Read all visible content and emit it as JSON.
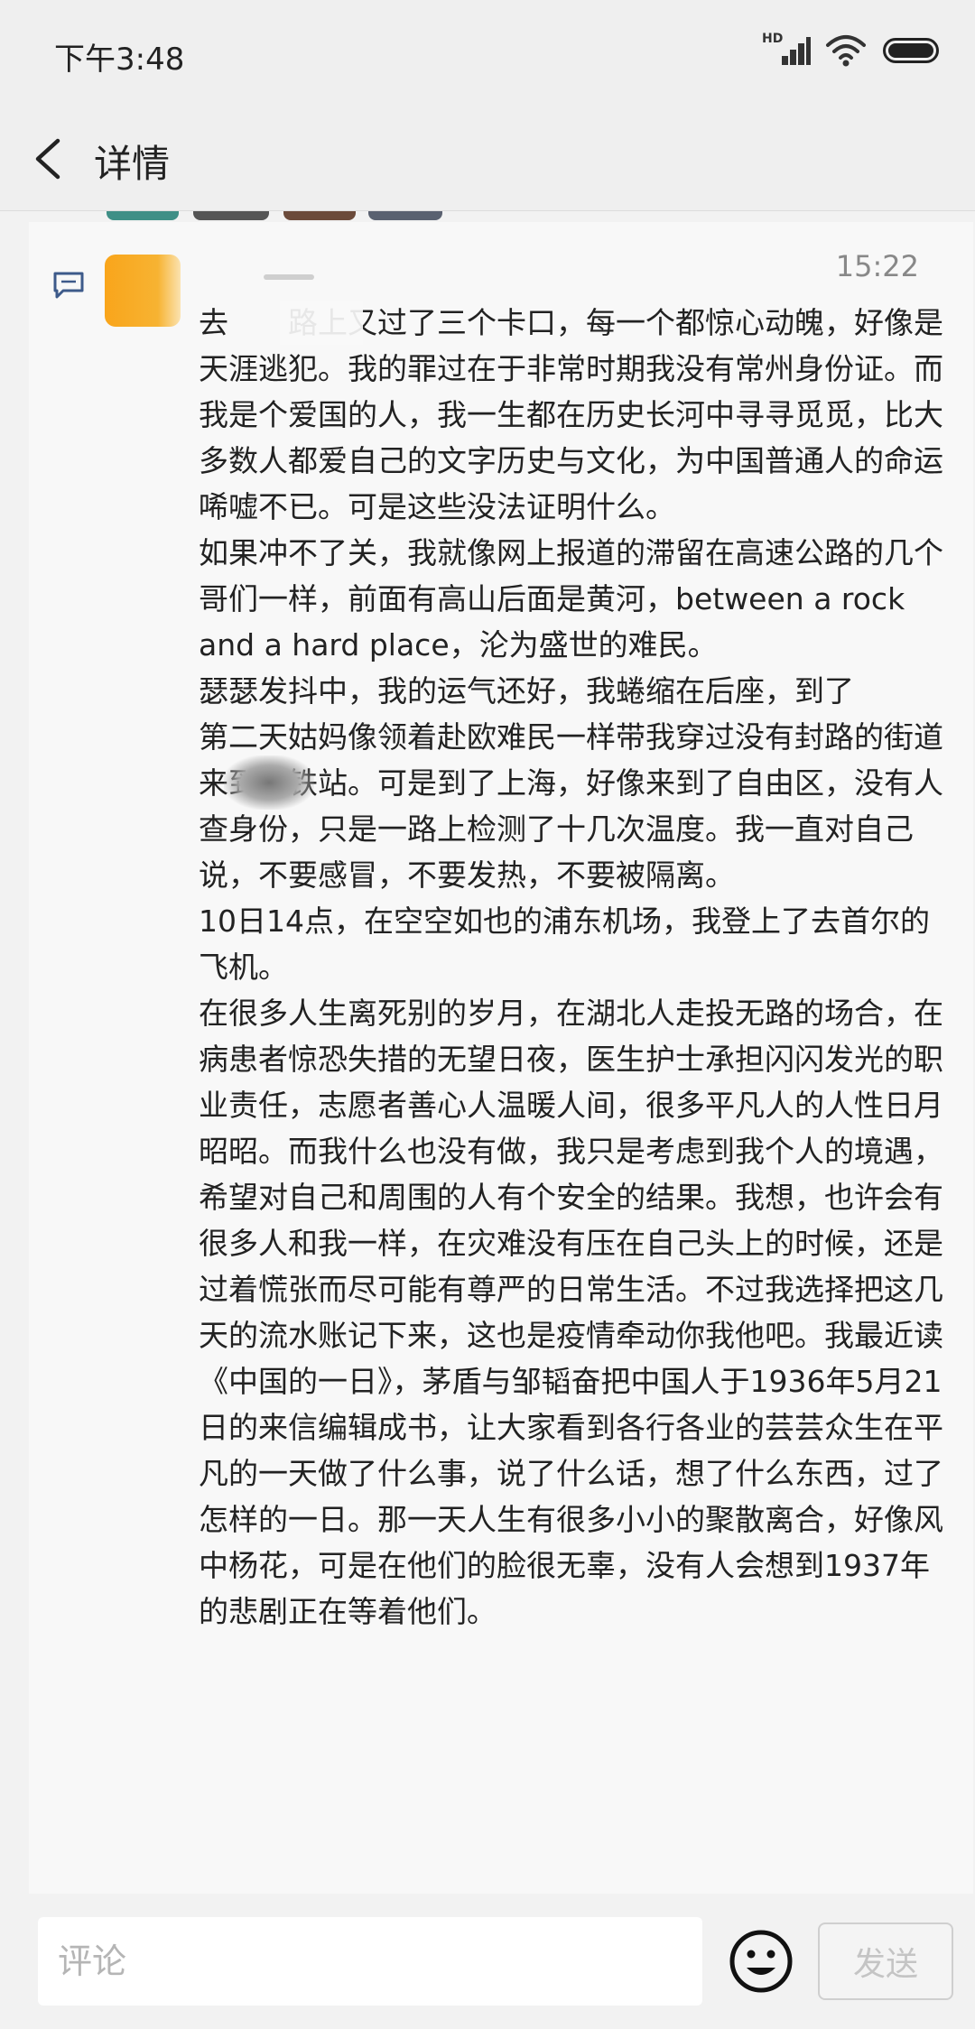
{
  "status_bar": {
    "time": "下午3:48",
    "network_label": "HD",
    "icons": [
      "signal-icon",
      "wifi-icon",
      "battery-icon"
    ]
  },
  "header": {
    "title": "详情",
    "back_icon": "chevron-left-icon"
  },
  "post": {
    "timestamp": "15:22",
    "paragraphs": [
      "去　　路上又过了三个卡口，每一个都惊心动魄，好像是天涯逃犯。我的罪过在于非常时期我没有常州身份证。而我是个爱国的人，我一生都在历史长河中寻寻觅觅，比大多数人都爱自己的文字历史与文化，为中国普通人的命运唏嘘不已。可是这些没法证明什么。",
      "如果冲不了关，我就像网上报道的滞留在高速公路的几个哥们一样，前面有高山后面是黄河，between a rock and a hard place，沦为盛世的难民。",
      "瑟瑟发抖中，我的运气还好，我蜷缩在后座，到了　　　第二天姑妈像领着赴欧难民一样带我穿过没有封路的街道来到高铁站。可是到了上海，好像来到了自由区，没有人查身份，只是一路上检测了十几次温度。我一直对自己说，不要感冒，不要发热，不要被隔离。",
      "10日14点，在空空如也的浦东机场，我登上了去首尔的飞机。",
      "在很多人生离死别的岁月，在湖北人走投无路的场合，在病患者惊恐失措的无望日夜，医生护士承担闪闪发光的职业责任，志愿者善心人温暖人间，很多平凡人的人性日月昭昭。而我什么也没有做，我只是考虑到我个人的境遇，希望对自己和周围的人有个安全的结果。我想，也许会有很多人和我一样，在灾难没有压在自己头上的时候，还是过着慌张而尽可能有尊严的日常生活。不过我选择把这几天的流水账记下来，这也是疫情牵动你我他吧。我最近读《中国的一日》，茅盾与邹韬奋把中国人于1936年5月21日的来信编辑成书，让大家看到各行各业的芸芸众生在平凡的一天做了什么事，说了什么话，想了什么东西，过了怎样的一日。那一天人生有很多小小的聚散离合，好像风中杨花，可是在他们的脸很无辜，没有人会想到1937年的悲剧正在等着他们。"
    ]
  },
  "bottom_bar": {
    "comment_placeholder": "评论",
    "emoji_icon": "smiley-icon",
    "send_label": "发送"
  },
  "colors": {
    "avatar": "#f9a51b",
    "comment_icon": "#3d5a8a",
    "send_disabled_text": "#c4c4c4"
  }
}
